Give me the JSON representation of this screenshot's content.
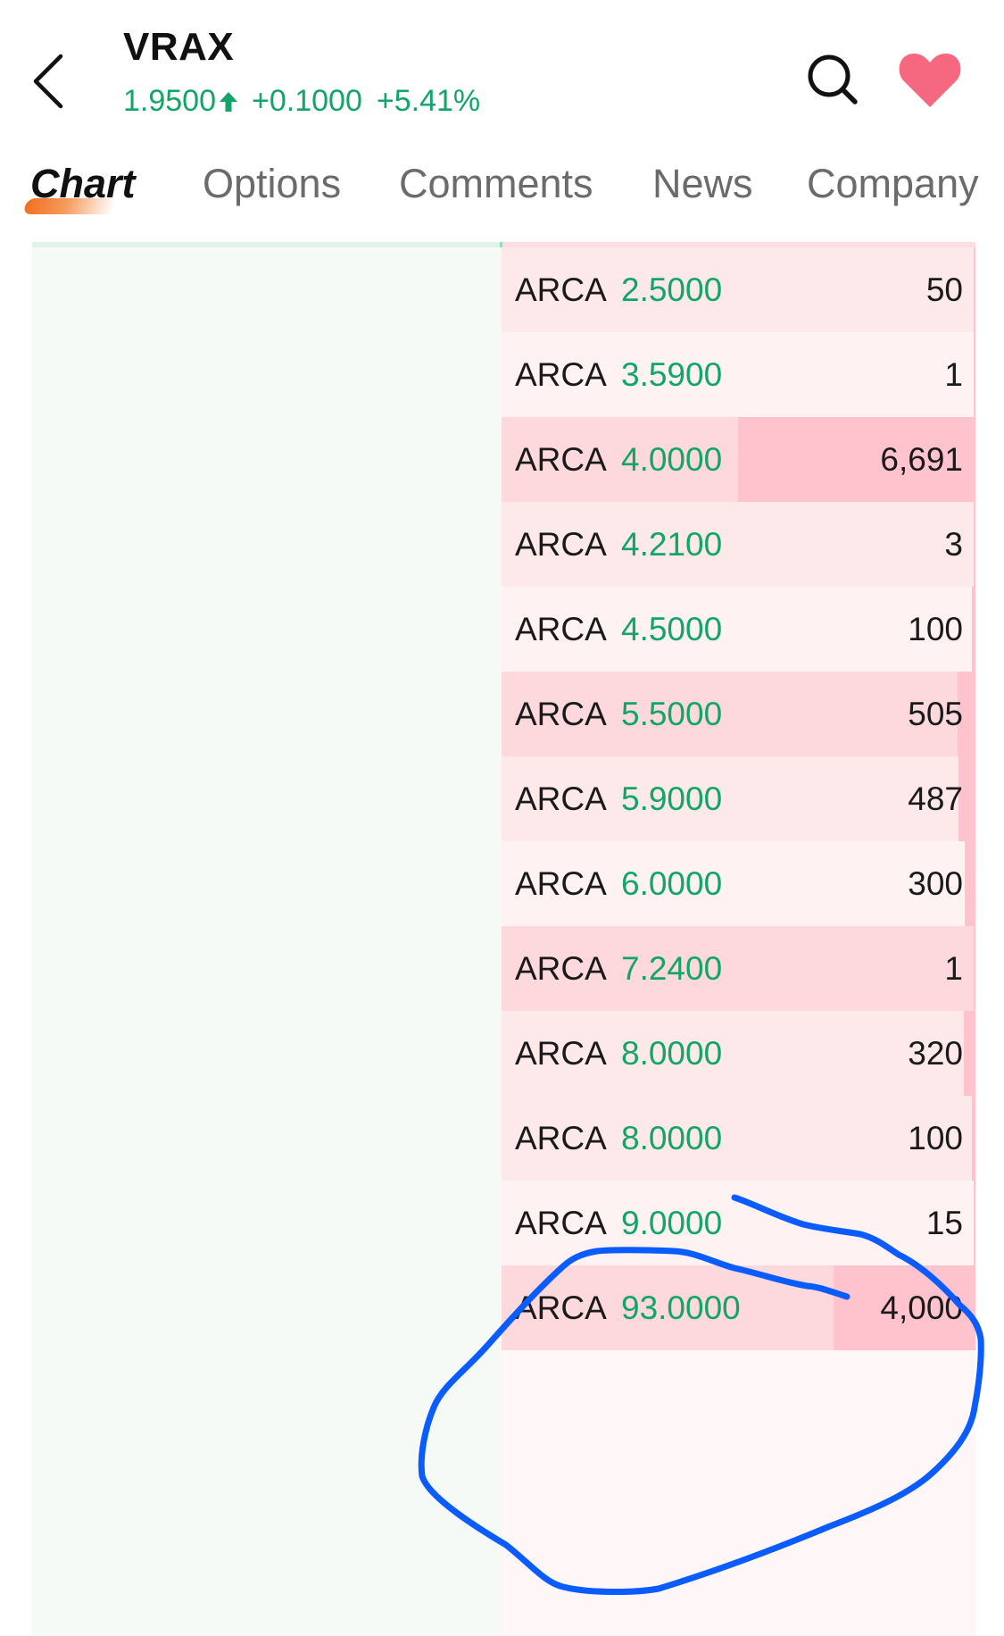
{
  "header": {
    "ticker": "VRAX",
    "last_price": "1.9500",
    "direction_icon": "arrow-up-icon",
    "change": "+0.1000",
    "change_pct": "+5.41%",
    "back_icon": "chevron-left-icon",
    "search_icon": "search-icon",
    "favorite_icon": "heart-filled-icon"
  },
  "colors": {
    "up": "#12a567",
    "favorite": "#f5687f",
    "tab_accent": "#f07020",
    "annotation": "#0a5cff"
  },
  "tabs": [
    {
      "label": "Chart",
      "active": true
    },
    {
      "label": "Options",
      "active": false
    },
    {
      "label": "Comments",
      "active": false
    },
    {
      "label": "News",
      "active": false
    },
    {
      "label": "Company",
      "active": false
    }
  ],
  "order_book": {
    "side": "ask",
    "max_volume": 6691,
    "rows": [
      {
        "exchange": "ARCA",
        "price": "2.5000",
        "volume": "50",
        "volume_num": 50,
        "shade": "a"
      },
      {
        "exchange": "ARCA",
        "price": "3.5900",
        "volume": "1",
        "volume_num": 1,
        "shade": "b"
      },
      {
        "exchange": "ARCA",
        "price": "4.0000",
        "volume": "6,691",
        "volume_num": 6691,
        "shade": "c"
      },
      {
        "exchange": "ARCA",
        "price": "4.2100",
        "volume": "3",
        "volume_num": 3,
        "shade": "a"
      },
      {
        "exchange": "ARCA",
        "price": "4.5000",
        "volume": "100",
        "volume_num": 100,
        "shade": "b"
      },
      {
        "exchange": "ARCA",
        "price": "5.5000",
        "volume": "505",
        "volume_num": 505,
        "shade": "c"
      },
      {
        "exchange": "ARCA",
        "price": "5.9000",
        "volume": "487",
        "volume_num": 487,
        "shade": "a"
      },
      {
        "exchange": "ARCA",
        "price": "6.0000",
        "volume": "300",
        "volume_num": 300,
        "shade": "b"
      },
      {
        "exchange": "ARCA",
        "price": "7.2400",
        "volume": "1",
        "volume_num": 1,
        "shade": "c"
      },
      {
        "exchange": "ARCA",
        "price": "8.0000",
        "volume": "320",
        "volume_num": 320,
        "shade": "a"
      },
      {
        "exchange": "ARCA",
        "price": "8.0000",
        "volume": "100",
        "volume_num": 100,
        "shade": "a"
      },
      {
        "exchange": "ARCA",
        "price": "9.0000",
        "volume": "15",
        "volume_num": 15,
        "shade": "b"
      },
      {
        "exchange": "ARCA",
        "price": "93.0000",
        "volume": "4,000",
        "volume_num": 4000,
        "shade": "c"
      }
    ]
  },
  "annotation": {
    "type": "hand-drawn-circle",
    "target": "ARCA 93.0000 4,000"
  }
}
